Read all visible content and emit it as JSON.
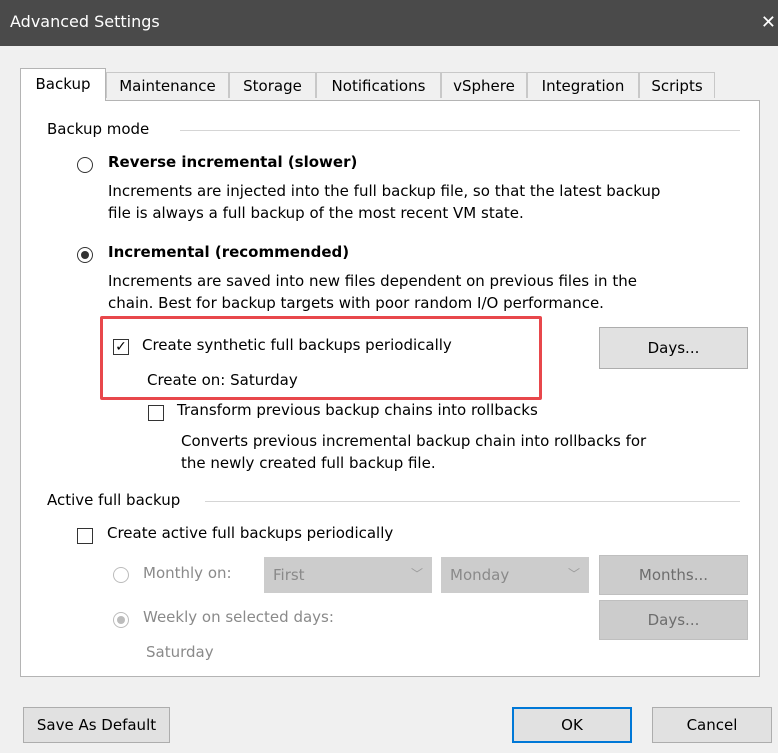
{
  "window": {
    "title": "Advanced Settings",
    "close_glyph": "✕"
  },
  "tabs": [
    {
      "label": "Backup",
      "active": true
    },
    {
      "label": "Maintenance"
    },
    {
      "label": "Storage"
    },
    {
      "label": "Notifications"
    },
    {
      "label": "vSphere"
    },
    {
      "label": "Integration"
    },
    {
      "label": "Scripts"
    }
  ],
  "backup_mode": {
    "group_label": "Backup mode",
    "reverse": {
      "label": "Reverse incremental (slower)",
      "desc_line1": "Increments are injected into the full backup file, so that the latest backup",
      "desc_line2": "file is always a full backup of the most recent VM state.",
      "selected": false
    },
    "incremental": {
      "label": "Incremental (recommended)",
      "desc_line1": "Increments are saved into new files dependent on previous files in the",
      "desc_line2": "chain. Best for backup targets with poor random I/O performance.",
      "selected": true
    },
    "synthetic": {
      "label": "Create synthetic full backups periodically",
      "checked": true,
      "create_on": "Create on:  Saturday",
      "days_button": "Days..."
    },
    "transform": {
      "label": "Transform previous backup chains into rollbacks",
      "checked": false,
      "desc_line1": "Converts previous incremental backup chain into rollbacks for",
      "desc_line2": "the newly created full backup file."
    }
  },
  "active_full": {
    "group_label": "Active full backup",
    "create_label": "Create active full backups periodically",
    "checked": false,
    "monthly_label": "Monthly on:",
    "monthly_week": "First",
    "monthly_day": "Monday",
    "months_button": "Months...",
    "weekly_label": "Weekly on selected days:",
    "weekly_days_button": "Days...",
    "weekly_value": "Saturday"
  },
  "footer": {
    "save_default": "Save As Default",
    "ok": "OK",
    "cancel": "Cancel"
  },
  "colors": {
    "titlebar": "#4a4a4a",
    "highlight": "#e8474b",
    "primary_border": "#0078d7"
  }
}
